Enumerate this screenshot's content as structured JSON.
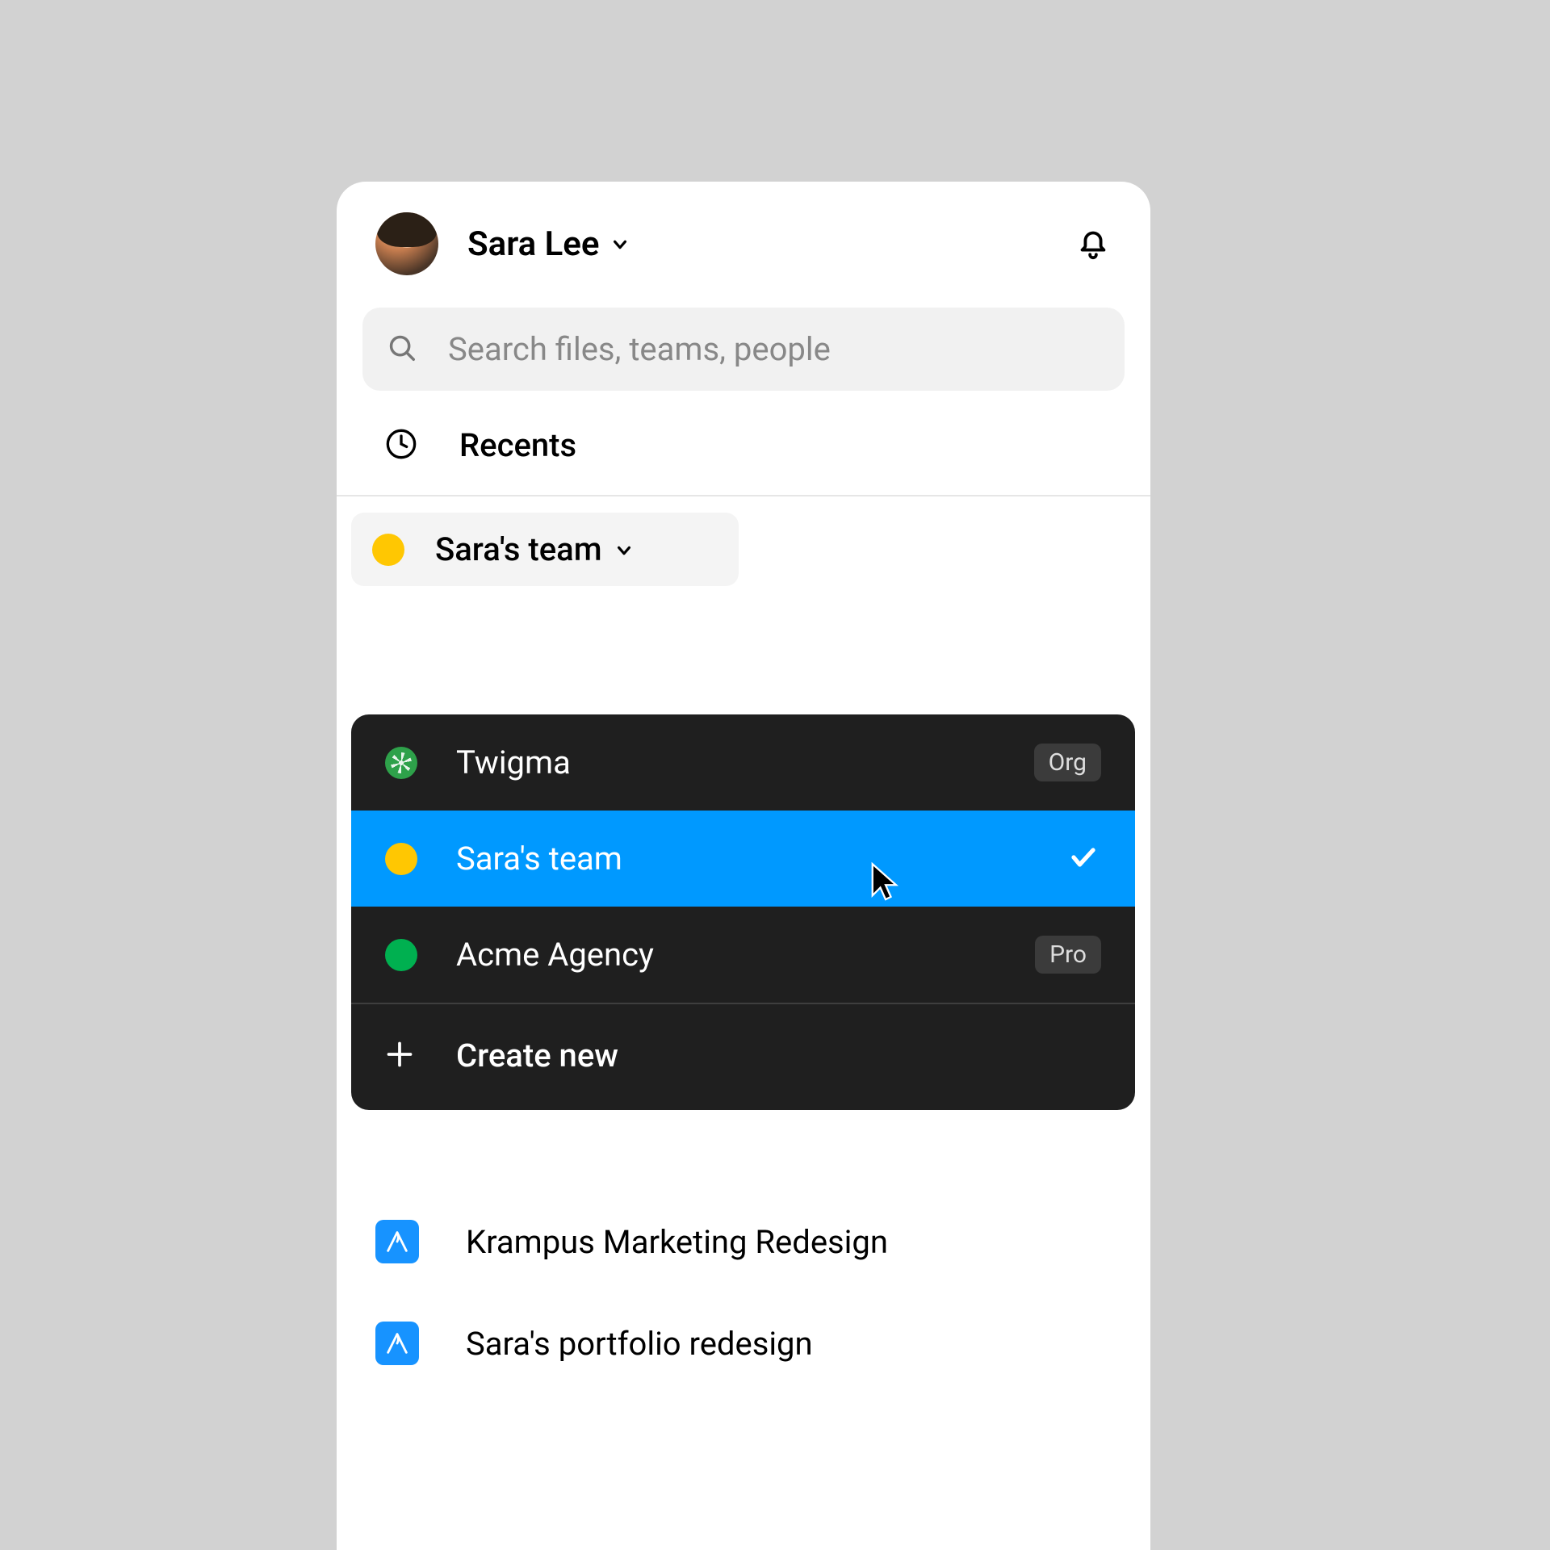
{
  "header": {
    "user_name": "Sara Lee"
  },
  "search": {
    "placeholder": "Search files, teams, people"
  },
  "recents": {
    "label": "Recents"
  },
  "team_selector": {
    "label": "Sara's team",
    "color": "#ffc702"
  },
  "dropdown": {
    "items": [
      {
        "label": "Twigma",
        "badge": "Org",
        "color": "green-pattern",
        "selected": false
      },
      {
        "label": "Sara's team",
        "badge": null,
        "color": "#ffc702",
        "selected": true
      },
      {
        "label": "Acme Agency",
        "badge": "Pro",
        "color": "#00b050",
        "selected": false
      }
    ],
    "create_label": "Create new"
  },
  "files": [
    {
      "label": "Krampus Marketing Redesign"
    },
    {
      "label": "Sara's portfolio redesign"
    }
  ]
}
